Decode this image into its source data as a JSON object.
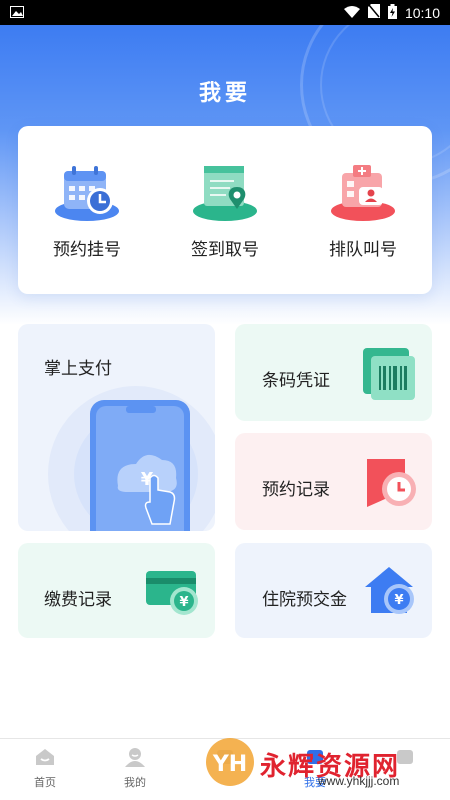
{
  "status_bar": {
    "time": "10:10"
  },
  "header": {
    "title": "我要"
  },
  "quick_actions": [
    {
      "label": "预约挂号",
      "icon": "calendar-clock-icon"
    },
    {
      "label": "签到取号",
      "icon": "ticket-pin-icon"
    },
    {
      "label": "排队叫号",
      "icon": "hospital-queue-icon"
    }
  ],
  "tiles": {
    "mobile_pay": {
      "label": "掌上支付",
      "icon": "phone-yuan-icon"
    },
    "barcode": {
      "label": "条码凭证",
      "icon": "barcode-scan-icon"
    },
    "appointment_record": {
      "label": "预约记录",
      "icon": "calendar-clock-icon"
    },
    "payment_record": {
      "label": "缴费记录",
      "icon": "card-yuan-icon"
    },
    "deposit": {
      "label": "住院预交金",
      "icon": "house-yuan-icon"
    }
  },
  "tabbar": {
    "items": [
      {
        "label": "首页",
        "icon": "home-icon"
      },
      {
        "label": "我的",
        "icon": "user-icon"
      },
      {
        "label": "",
        "icon": "tab-icon"
      },
      {
        "label": "我要",
        "icon": "tab-icon",
        "active": true
      },
      {
        "label": "",
        "icon": "tab-icon"
      }
    ]
  },
  "watermark": {
    "text": "永辉资源网",
    "url": "www.yhkjjj.com"
  },
  "colors": {
    "primary": "#3d7cf2",
    "accent_red": "#f2515a",
    "accent_green": "#2bb58c"
  }
}
